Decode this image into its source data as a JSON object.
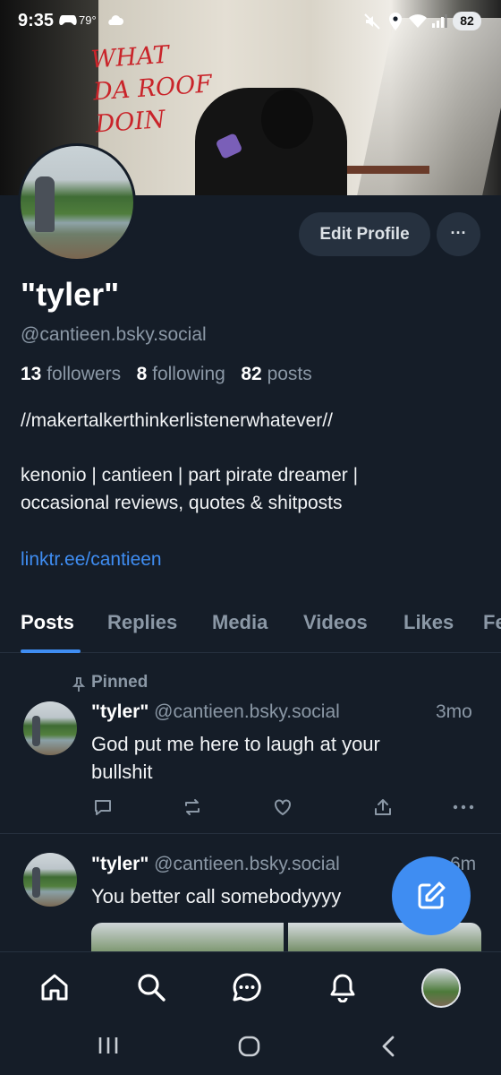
{
  "status_bar": {
    "time": "9:35",
    "weather": "79°",
    "battery": "82"
  },
  "banner": {
    "graffiti_text": "WHAT\nDA ROOF\nDOIN"
  },
  "profile": {
    "edit_label": "Edit Profile",
    "more_label": "···",
    "display_name": "\"tyler\"",
    "handle": "@cantieen.bsky.social",
    "followers_count": "13",
    "followers_label": "followers",
    "following_count": "8",
    "following_label": "following",
    "posts_count": "82",
    "posts_label": "posts",
    "bio_line_1": "//makertalkerthinkerlistenerwhatever//",
    "bio_line_2": "kenonio | cantieen | part pirate dreamer |",
    "bio_line_3": "occasional reviews, quotes & shitposts",
    "link": "linktr.ee/cantieen"
  },
  "tabs": [
    {
      "label": "Posts",
      "active": true
    },
    {
      "label": "Replies",
      "active": false
    },
    {
      "label": "Media",
      "active": false
    },
    {
      "label": "Videos",
      "active": false
    },
    {
      "label": "Likes",
      "active": false
    },
    {
      "label": "Fe",
      "active": false
    }
  ],
  "posts": [
    {
      "pinned_label": "Pinned",
      "author": "\"tyler\"",
      "handle": "@cantieen.bsky.social",
      "time": "3mo",
      "text_line_1": "God put me here to laugh at your",
      "text_line_2": "bullshit"
    },
    {
      "author": "\"tyler\"",
      "handle": "@cantieen.bsky.social",
      "time": "6m",
      "text_line_1": "You better call somebodyyyy"
    }
  ],
  "icons": {
    "reply": "reply-icon",
    "repost": "repost-icon",
    "like": "heart-icon",
    "share": "share-icon",
    "more": "more-icon",
    "compose": "compose-icon",
    "home": "home-icon",
    "search": "search-icon",
    "chat": "chat-icon",
    "notifications": "bell-icon"
  },
  "colors": {
    "background": "#151d28",
    "accent": "#3f8df2",
    "muted": "#8b98a6",
    "button_bg": "#26313f"
  }
}
